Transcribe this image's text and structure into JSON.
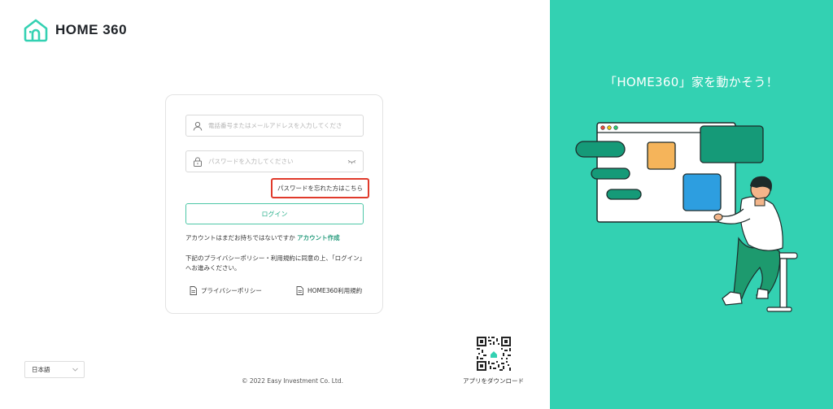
{
  "brand": {
    "name": "HOME 360",
    "accent": "#33d1b2"
  },
  "login": {
    "user_placeholder": "電話番号またはメールアドレスを入力してくださ",
    "password_placeholder": "パスワードを入力してください",
    "forgot_label": "パスワードを忘れた方はこちら",
    "login_button": "ログイン",
    "no_account_text": "アカウントはまだお持ちではないですか",
    "create_account_link": "アカウント作成",
    "agreement_text": "下記のプライバシーポリシー・利用規約に同意の上、「ログイン」へお進みください。",
    "privacy_link": "プライバシーポリシー",
    "terms_link": "HOME360利用規約"
  },
  "footer": {
    "language": "日本語",
    "copyright": "© 2022 Easy Investment Co. Ltd.",
    "download_caption": "アプリをダウンロード"
  },
  "hero": {
    "tagline": "「HOME360」家を動かそう！"
  },
  "icons": {
    "logo": "house-logo-icon",
    "user": "user-icon",
    "lock": "lock-icon",
    "eye": "eye-closed-icon",
    "document": "document-icon",
    "chevron": "chevron-down-icon"
  }
}
